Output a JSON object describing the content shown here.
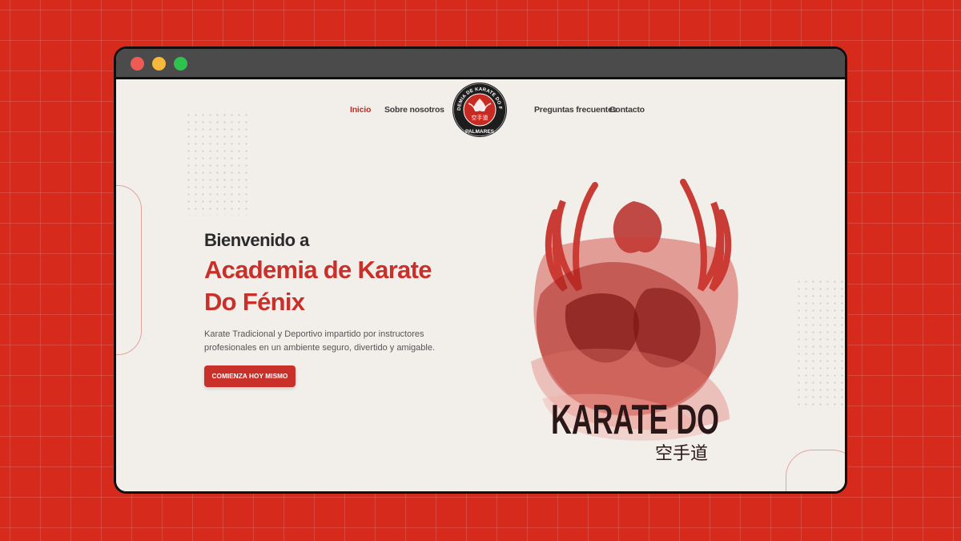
{
  "nav": {
    "items": [
      "Inicio",
      "Sobre nosotros",
      "Preguntas frecuentes",
      "Contacto"
    ],
    "active": "Inicio"
  },
  "logo": {
    "top_text": "ACADEMIA DE KARATE DO FENIX",
    "kanji": "空手道",
    "bottom_text": "PALMARES"
  },
  "hero": {
    "pre_title": "Bienvenido a",
    "title": "Academia de Karate Do Fénix",
    "description": "Karate Tradicional y Deportivo impartido por instructores profesionales en un ambiente seguro, divertido y amigable.",
    "cta_label": "COMIENZA HOY MISMO"
  },
  "art": {
    "title": "KARATE DO",
    "kanji": "空手道"
  },
  "colors": {
    "accent": "#c9302a",
    "background": "#d52a1c",
    "page": "#f2efeb"
  }
}
